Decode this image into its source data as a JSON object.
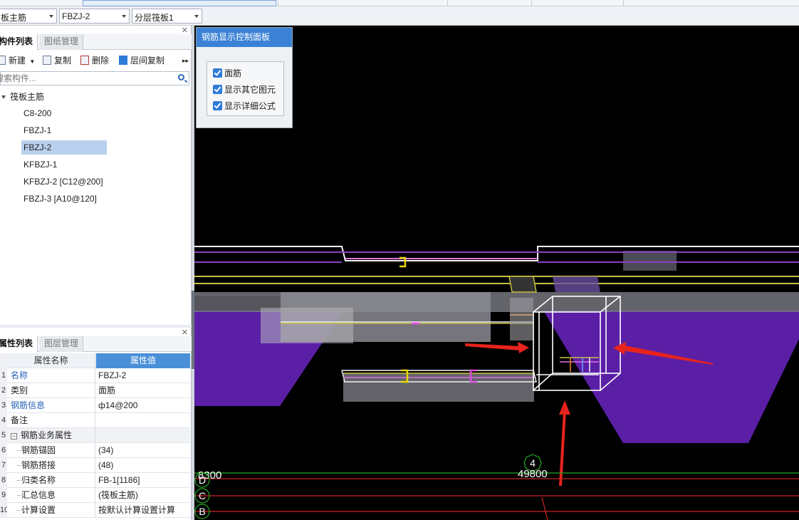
{
  "selectors": {
    "type_value": "板主筋",
    "component_value": "FBZJ-2",
    "layer_value": "分层筏板1"
  },
  "component_panel": {
    "tabs": [
      "构件列表",
      "图纸管理"
    ],
    "toolbar": {
      "new": "新建",
      "copy": "复制",
      "delete": "删除",
      "floor_copy": "层间复制",
      "more": "▸▸"
    },
    "search_placeholder": "搜索构件...",
    "tree_root": "筏板主筋",
    "items": [
      "C8-200",
      "FBZJ-1",
      "FBZJ-2",
      "KFBZJ-1",
      "KFBZJ-2 [C12@200]",
      "FBZJ-3 [A10@120]"
    ],
    "selected_item": "FBZJ-2"
  },
  "property_panel": {
    "tabs": [
      "属性列表",
      "图层管理"
    ],
    "header": {
      "name": "属性名称",
      "value": "属性值"
    },
    "rows": [
      {
        "num": "1",
        "name": "名称",
        "value": "FBZJ-2"
      },
      {
        "num": "2",
        "name": "类别",
        "value": "面筋"
      },
      {
        "num": "3",
        "name": "钢筋信息",
        "value": "ф14@200"
      },
      {
        "num": "4",
        "name": "备注",
        "value": ""
      },
      {
        "num": "5",
        "name": "钢筋业务属性",
        "value": ""
      },
      {
        "num": "6",
        "name": "钢筋锚固",
        "value": "(34)"
      },
      {
        "num": "7",
        "name": "钢筋搭接",
        "value": "(48)"
      },
      {
        "num": "8",
        "name": "归类名称",
        "value": "FB-1[1186]"
      },
      {
        "num": "9",
        "name": "汇总信息",
        "value": "(筏板主筋)"
      },
      {
        "num": "10",
        "name": "计算设置",
        "value": "按默认计算设置计算"
      }
    ]
  },
  "control_panel": {
    "title": "钢筋显示控制面板",
    "options": [
      {
        "label": "面筋",
        "checked": true
      },
      {
        "label": "显示其它图元",
        "checked": true
      },
      {
        "label": "显示详细公式",
        "checked": true
      }
    ]
  },
  "viewport": {
    "dim_left": "8300",
    "dim_mid": "49800",
    "axis_top": "4",
    "axis_labels": [
      "D",
      "C",
      "B"
    ]
  },
  "colors": {
    "accent": "#3b82d6",
    "purple": "#5b1fa6",
    "arrow": "#e8231d",
    "selected": "#b9d1ef"
  }
}
